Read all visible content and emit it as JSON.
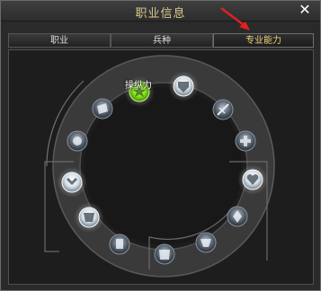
{
  "window": {
    "title": "职业信息",
    "close_label": "✕"
  },
  "tabs": [
    {
      "label": "职业",
      "active": false
    },
    {
      "label": "兵种",
      "active": false
    },
    {
      "label": "专业能力",
      "active": true
    }
  ],
  "wheel": {
    "highlight_label": "操纵力",
    "nodes": [
      {
        "name": "node-green-active",
        "icon": "green-burst-icon",
        "state": "active"
      },
      {
        "name": "node-shield-top",
        "icon": "shield-icon",
        "state": "lit"
      },
      {
        "name": "node-sword",
        "icon": "sword-icon",
        "state": "dim"
      },
      {
        "name": "node-cross-right",
        "icon": "cross-icon",
        "state": "dim"
      },
      {
        "name": "node-heart-right",
        "icon": "heart-icon",
        "state": "lit"
      },
      {
        "name": "node-crystal-right",
        "icon": "crystal-icon",
        "state": "dim"
      },
      {
        "name": "node-gem-lower-right",
        "icon": "gem-icon",
        "state": "dim"
      },
      {
        "name": "node-armor-bottom",
        "icon": "armor-icon",
        "state": "dim"
      },
      {
        "name": "node-tower-lower-left",
        "icon": "tower-icon",
        "state": "dim"
      },
      {
        "name": "node-hammer-left",
        "icon": "hammer-icon",
        "state": "lit"
      },
      {
        "name": "node-wing-left",
        "icon": "wing-icon",
        "state": "lit"
      },
      {
        "name": "node-burst-left",
        "icon": "burst-icon",
        "state": "dim"
      },
      {
        "name": "node-scroll-upper-left",
        "icon": "scroll-icon",
        "state": "dim"
      }
    ]
  },
  "colors": {
    "accent": "#e8d27a",
    "arrow": "#e02020",
    "active_node": "#7ddc1f"
  }
}
